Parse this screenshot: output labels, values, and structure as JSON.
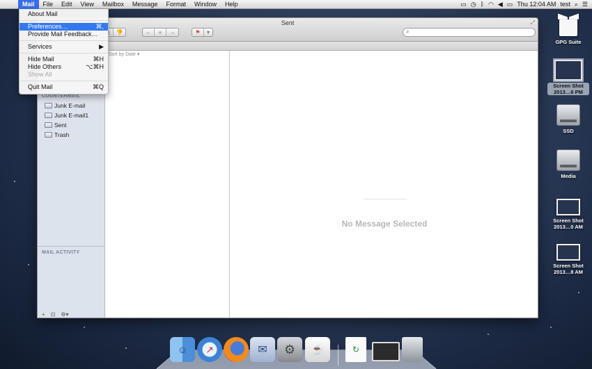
{
  "menubar": {
    "apple_icon": "",
    "items": [
      "Mail",
      "File",
      "Edit",
      "View",
      "Mailbox",
      "Message",
      "Format",
      "Window",
      "Help"
    ],
    "active_item": "Mail",
    "status_icons": [
      "airplay-icon",
      "time-machine-icon",
      "bluetooth-icon",
      "wifi-icon",
      "volume-icon",
      "battery-icon"
    ],
    "clock": "Thu 12:04 AM",
    "user": "test",
    "spotlight_icon": "search-icon",
    "notification_icon": "list-icon"
  },
  "mail_menu": {
    "about": {
      "label": "About Mail",
      "shortcut": ""
    },
    "preferences": {
      "label": "Preferences…",
      "shortcut": "⌘,"
    },
    "feedback": {
      "label": "Provide Mail Feedback…",
      "shortcut": ""
    },
    "services": {
      "label": "Services",
      "shortcut": "▶"
    },
    "hide_mail": {
      "label": "Hide Mail",
      "shortcut": "⌘H"
    },
    "hide_others": {
      "label": "Hide Others",
      "shortcut": "⌥⌘H"
    },
    "show_all": {
      "label": "Show All",
      "shortcut": ""
    },
    "quit": {
      "label": "Quit Mail",
      "shortcut": "⌘Q"
    }
  },
  "window": {
    "title": "Sent",
    "search_placeholder": "",
    "sort_label": "Sort by Date ▾",
    "no_message": "No Message Selected"
  },
  "sidebar": {
    "account_header": "COUNTERMAIL",
    "mailboxes": [
      "Junk E-mail",
      "Junk E-mail1",
      "Sent",
      "Trash"
    ],
    "activity_header": "MAIL ACTIVITY",
    "bottom": {
      "add": "+",
      "view": "⊡",
      "gear": "⚙▾"
    }
  },
  "desktop": {
    "icons": [
      {
        "label": "GPG Suite",
        "kind": "gpg-suite-icon"
      },
      {
        "label": "Screen Shot 2013…6 PM",
        "kind": "screenshot-icon",
        "selected": true
      },
      {
        "label": "SSD",
        "kind": "hard-drive-icon"
      },
      {
        "label": "Media",
        "kind": "hard-drive-icon"
      },
      {
        "label": "Screen Shot 2013…0 AM",
        "kind": "screenshot-icon"
      },
      {
        "label": "Screen Shot 2013…8 AM",
        "kind": "screenshot-icon"
      }
    ]
  },
  "dock": {
    "apps": [
      "finder-icon",
      "safari-icon",
      "firefox-icon",
      "mail-icon",
      "system-preferences-icon",
      "java-icon"
    ],
    "right_items": [
      "document-icon",
      "window-icon",
      "trash-icon"
    ]
  }
}
